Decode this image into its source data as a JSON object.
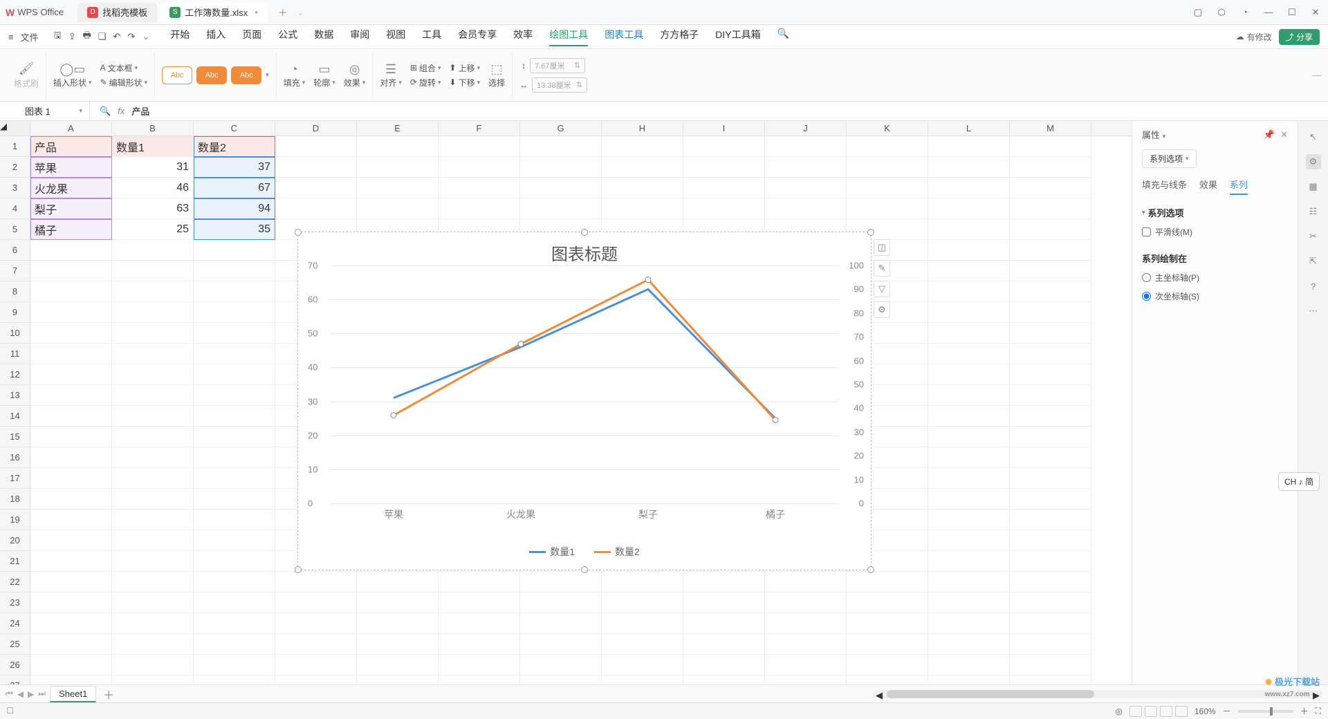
{
  "title_bar": {
    "app_name": "WPS Office",
    "tabs": [
      {
        "label": "找稻壳模板",
        "icon": "D",
        "iconClass": "red"
      },
      {
        "label": "工作簿数量.xlsx",
        "icon": "S",
        "iconClass": "green",
        "dot": "•"
      }
    ]
  },
  "menu": {
    "file": "文件",
    "items": [
      "开始",
      "插入",
      "页面",
      "公式",
      "数据",
      "审阅",
      "视图",
      "工具",
      "会员专享",
      "效率",
      "绘图工具",
      "图表工具",
      "方方格子",
      "DIY工具箱"
    ],
    "modify": "有修改",
    "share": "分享"
  },
  "ribbon": {
    "format_painter": "格式刷",
    "insert_shape": "插入形状",
    "text_box": "文本框",
    "edit_shape": "编辑形状",
    "abc": "Abc",
    "fill": "填充",
    "outline": "轮廓",
    "effects": "效果",
    "align": "对齐",
    "group": "组合",
    "rotate": "旋转",
    "up": "上移",
    "down": "下移",
    "select": "选择",
    "w": "7.67厘米",
    "h": "13.38厘米"
  },
  "formula": {
    "name_box": "图表 1",
    "value": "产品"
  },
  "sheet": {
    "cols": [
      "A",
      "B",
      "C",
      "D",
      "E",
      "F",
      "G",
      "H",
      "I",
      "J",
      "K",
      "L",
      "M"
    ],
    "rows": [
      {
        "A": "产品",
        "B": "数量1",
        "C": "数量2"
      },
      {
        "A": "苹果",
        "B": "31",
        "C": "37"
      },
      {
        "A": "火龙果",
        "B": "46",
        "C": "67"
      },
      {
        "A": "梨子",
        "B": "63",
        "C": "94"
      },
      {
        "A": "橘子",
        "B": "25",
        "C": "35"
      }
    ]
  },
  "chart_data": {
    "type": "line",
    "title": "图表标题",
    "categories": [
      "苹果",
      "火龙果",
      "梨子",
      "橘子"
    ],
    "series": [
      {
        "name": "数量1",
        "values": [
          31,
          46,
          63,
          25
        ],
        "axis": "primary",
        "color": "#4a90d9"
      },
      {
        "name": "数量2",
        "values": [
          37,
          67,
          94,
          35
        ],
        "axis": "secondary",
        "color": "#f08b3a"
      }
    ],
    "xlabel": "",
    "ylabel_left": "",
    "ylabel_right": "",
    "ylim_left": [
      0,
      70
    ],
    "ylim_right": [
      0,
      100
    ],
    "yticks_left": [
      0,
      10,
      20,
      30,
      40,
      50,
      60,
      70
    ],
    "yticks_right": [
      0,
      10,
      20,
      30,
      40,
      50,
      60,
      70,
      80,
      90,
      100
    ],
    "legend_position": "bottom"
  },
  "panel": {
    "title": "属性",
    "series_options_btn": "系列选项",
    "subtabs": [
      "填充与线条",
      "效果",
      "系列"
    ],
    "active_subtab": "系列",
    "section1": "系列选项",
    "smooth": "平滑线(M)",
    "section2": "系列绘制在",
    "primary": "主坐标轴(P)",
    "secondary": "次坐标轴(S)"
  },
  "sheet_tabs": {
    "sheet1": "Sheet1"
  },
  "status": {
    "zoom": "160%",
    "ch": "CH ♪ 简"
  },
  "watermark": {
    "text": "极光下载站",
    "url": "www.xz7.com"
  }
}
